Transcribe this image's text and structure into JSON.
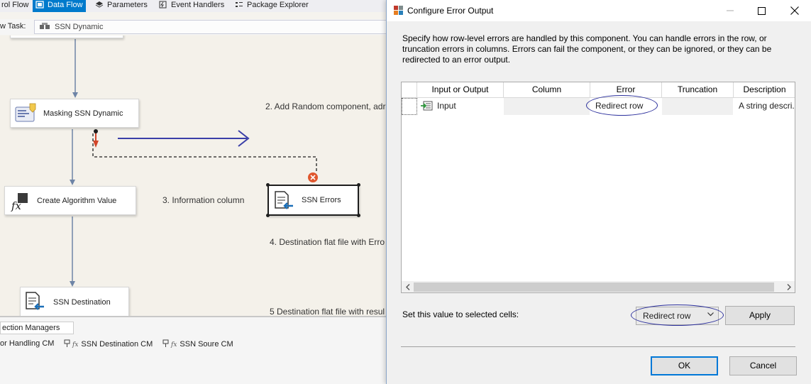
{
  "designer": {
    "tabs": [
      {
        "label": "rol Flow",
        "icon": ""
      },
      {
        "label": "Data Flow",
        "icon": "data-flow-icon"
      },
      {
        "label": "Parameters",
        "icon": "parameters-icon"
      },
      {
        "label": "Event Handlers",
        "icon": "event-handlers-icon"
      },
      {
        "label": "Package Explorer",
        "icon": "package-explorer-icon"
      }
    ],
    "task_label": "w Task:",
    "task_value": "SSN Dynamic",
    "nodes": {
      "masking": "Masking SSN Dynamic",
      "create_algorithm": "Create Algorithm Value",
      "ssn_errors": "SSN Errors",
      "ssn_destination": "SSN Destination"
    },
    "annotations": {
      "a2": "2. Add Random component, adr",
      "a3": "3. Information column",
      "a4": "4. Destination flat file with Erro",
      "a5": "5 Destination flat file with resul"
    },
    "connection_managers": {
      "tab_label": "ection Managers",
      "items": [
        "or Handling CM",
        "SSN Destination CM",
        "SSN Soure CM"
      ]
    }
  },
  "dialog": {
    "title": "Configure Error Output",
    "description": "Specify how row-level errors are handled by this component. You can handle errors in the row, or truncation errors in columns. Errors can fail the component, or they can be ignored, or they can be redirected to an error output.",
    "grid": {
      "columns": [
        "Input or Output",
        "Column",
        "Error",
        "Truncation",
        "Description"
      ],
      "rows": [
        {
          "io": "Input",
          "column": "",
          "error": "Redirect row",
          "truncation": "",
          "description": "A string descri..."
        }
      ]
    },
    "set_value_label": "Set this value to selected cells:",
    "set_value": "Redirect row",
    "apply_label": "Apply",
    "ok_label": "OK",
    "cancel_label": "Cancel"
  },
  "colors": {
    "accent": "#007acc",
    "highlight_circle": "#2b2f9c",
    "arrow": "#3a3fa8",
    "error_path": "#d2462a"
  }
}
